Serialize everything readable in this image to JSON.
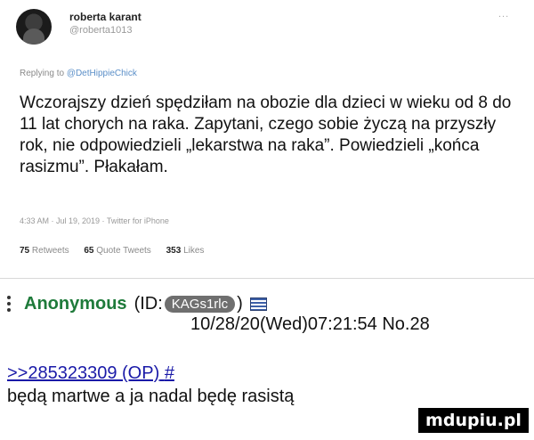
{
  "tweet": {
    "name": "roberta karant",
    "handle": "@roberta1013",
    "more": "...",
    "replying_prefix": "Replying to",
    "replying_to": "@DetHippieChick",
    "body": "Wczorajszy dzień spędziłam na obozie dla dzieci w wieku od 8 do 11 lat chorych na raka. Zapytani, czego sobie życzą na przyszły rok, nie odpowiedzieli „lekarstwa na raka”. Powiedzieli „końca rasizmu”. Płakałam.",
    "meta": "4:33 AM · Jul 19, 2019 · Twitter for iPhone",
    "retweets_count": "75",
    "retweets_label": "Retweets",
    "quotes_count": "65",
    "quotes_label": "Quote Tweets",
    "likes_count": "353",
    "likes_label": "Likes"
  },
  "post": {
    "name": "Anonymous",
    "id_prefix": "(ID:",
    "id_value": "KAGs1rlc",
    "id_suffix": ")",
    "datetime": "10/28/20(Wed)07:21:54 No.28",
    "reply_ref": ">>285323309 (OP)",
    "reply_hash": "#",
    "text": "będą martwe a ja nadal będę rasistą"
  },
  "watermark": "mdupiu.pl"
}
